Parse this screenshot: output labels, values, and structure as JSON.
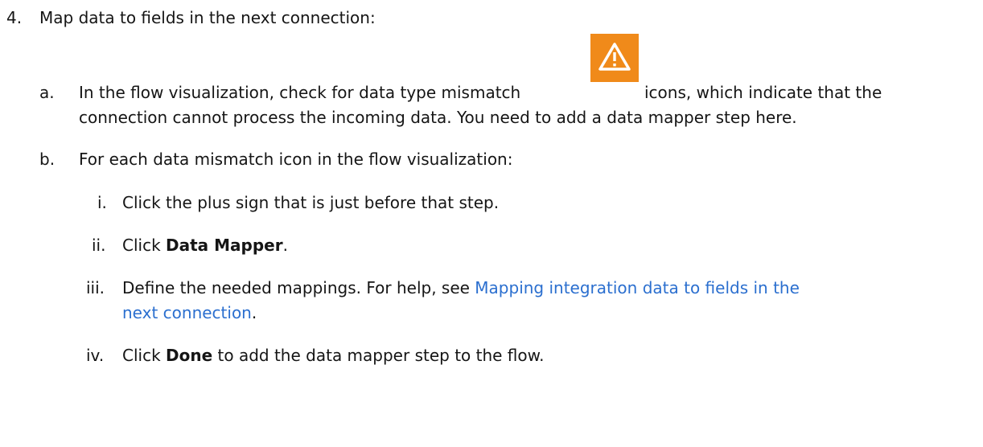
{
  "step": {
    "marker": "4.",
    "text": "Map data to fields in the next connection:"
  },
  "substep_a": {
    "marker": "a.",
    "text_before_icon": "In the flow visualization, check for data type mismatch",
    "icon": "warning-triangle-icon",
    "icon_color": "#f08a1a",
    "text_after_icon": "icons, which indicate that the",
    "line2": "connection cannot process the incoming data. You need to add a data mapper step here."
  },
  "substep_b": {
    "marker": "b.",
    "text": "For each data mismatch icon in the flow visualization:",
    "items": [
      {
        "marker": "i.",
        "text": "Click the plus sign that is just before that step."
      },
      {
        "marker": "ii.",
        "prefix": "Click ",
        "bold": "Data Mapper",
        "suffix": "."
      },
      {
        "marker": "iii.",
        "prefix": "Define the needed mappings. For help, see ",
        "link_line1": "Mapping integration data to fields in the",
        "link_line2": "next connection",
        "suffix": "."
      },
      {
        "marker": "iv.",
        "prefix": "Click ",
        "bold": "Done",
        "suffix": " to add the data mapper step to the flow."
      }
    ]
  },
  "colors": {
    "text": "#151515",
    "link": "#2b6fcf",
    "warning": "#f08a1a"
  }
}
